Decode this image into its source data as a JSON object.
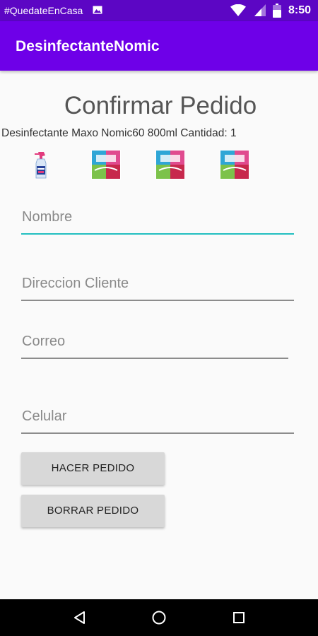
{
  "status_bar": {
    "hashtag": "#QuedateEnCasa",
    "time": "8:50",
    "icons": [
      "image-icon",
      "wifi-icon",
      "signal-icon",
      "battery-icon"
    ]
  },
  "app_bar": {
    "title": "DesinfectanteNomic"
  },
  "main": {
    "title": "Confirmar Pedido",
    "product_line": "Desinfectante Maxo Nomic60 800ml Cantidad: 1",
    "images": [
      "spray-bottle-image",
      "wipes-pack-image",
      "wipes-pack-image",
      "wipes-pack-image"
    ]
  },
  "form": {
    "nombre_placeholder": "Nombre",
    "direccion_placeholder": "Direccion Cliente",
    "correo_placeholder": "Correo",
    "celular_placeholder": "Celular"
  },
  "buttons": {
    "hacer_pedido": "HACER PEDIDO",
    "borrar_pedido": "BORRAR PEDIDO"
  },
  "colors": {
    "status_bar": "#5c06c4",
    "app_bar": "#6e00e8",
    "focus_underline": "#22bfc0",
    "button_bg": "#d8d8d8"
  },
  "nav_bar": {
    "icons": [
      "back-icon",
      "home-icon",
      "recents-icon"
    ]
  }
}
